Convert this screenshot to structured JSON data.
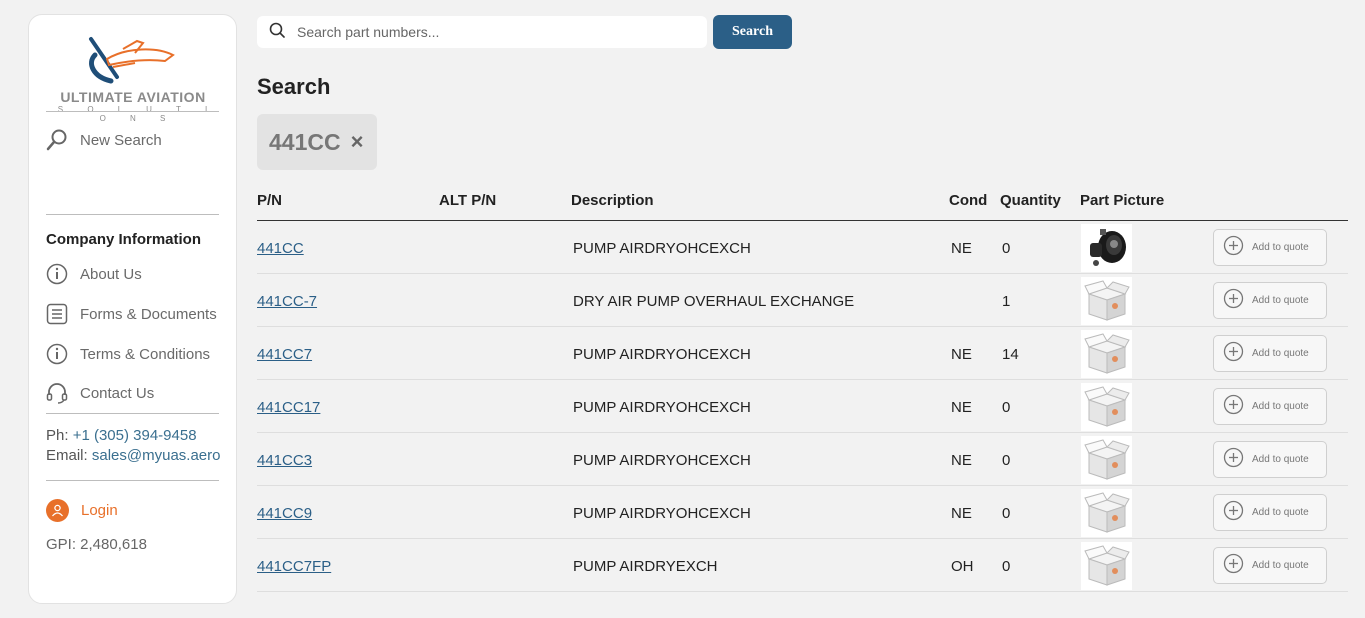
{
  "brand": {
    "name": "ULTIMATE AVIATION",
    "sub": "S O L U T I O N S"
  },
  "sidebar": {
    "new_search": "New Search",
    "company_heading": "Company Information",
    "items": [
      {
        "label": "About Us",
        "icon": "info-icon"
      },
      {
        "label": "Forms & Documents",
        "icon": "document-icon"
      },
      {
        "label": "Terms & Conditions",
        "icon": "info-icon"
      },
      {
        "label": "Contact Us",
        "icon": "headset-icon"
      }
    ],
    "phone_label": "Ph:",
    "phone": "+1 (305) 394-9458",
    "email_label": "Email:",
    "email": "sales@myuas.aero",
    "login": "Login",
    "gpi": "GPI: 2,480,618"
  },
  "search": {
    "placeholder": "Search part numbers...",
    "button": "Search"
  },
  "page_title": "Search",
  "filter_chip": {
    "label": "441CC",
    "remove": "×"
  },
  "table": {
    "headers": [
      "P/N",
      "ALT P/N",
      "Description",
      "Cond",
      "Quantity",
      "Part Picture"
    ],
    "add_label": "Add to quote",
    "rows": [
      {
        "pn": "441CC",
        "alt": "",
        "desc": "PUMP AIRDRYOHCEXCH",
        "cond": "NE",
        "qty": "0",
        "pic": "pump-photo"
      },
      {
        "pn": "441CC-7",
        "alt": "",
        "desc": "DRY AIR PUMP OVERHAUL EXCHANGE",
        "cond": "",
        "qty": "1",
        "pic": "box-placeholder"
      },
      {
        "pn": "441CC7",
        "alt": "",
        "desc": "PUMP AIRDRYOHCEXCH",
        "cond": "NE",
        "qty": "14",
        "pic": "box-placeholder"
      },
      {
        "pn": "441CC17",
        "alt": "",
        "desc": "PUMP AIRDRYOHCEXCH",
        "cond": "NE",
        "qty": "0",
        "pic": "box-placeholder"
      },
      {
        "pn": "441CC3",
        "alt": "",
        "desc": "PUMP AIRDRYOHCEXCH",
        "cond": "NE",
        "qty": "0",
        "pic": "box-placeholder"
      },
      {
        "pn": "441CC9",
        "alt": "",
        "desc": "PUMP AIRDRYOHCEXCH",
        "cond": "NE",
        "qty": "0",
        "pic": "box-placeholder"
      },
      {
        "pn": "441CC7FP",
        "alt": "",
        "desc": "PUMP AIRDRYEXCH",
        "cond": "OH",
        "qty": "0",
        "pic": "box-placeholder"
      }
    ]
  },
  "colors": {
    "accent": "#2b5f87",
    "login": "#e8702a",
    "background": "#f2f2f2"
  }
}
